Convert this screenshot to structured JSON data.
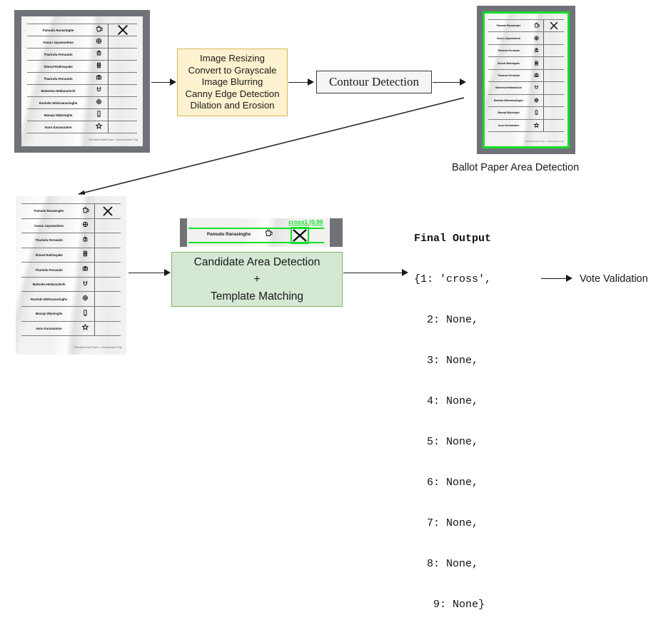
{
  "diagram": {
    "title": "Ballot paper vote detection pipeline",
    "colors": {
      "yellow_fill": "#fdf2cf",
      "yellow_stroke": "#d6b656",
      "green_fill": "#d5e8d4",
      "green_stroke": "#82b366",
      "white_fill": "#f5f5f5",
      "white_stroke": "#3a3a3a",
      "detection_green": "#12e029",
      "frame_gray": "#6f7277",
      "text": "#1a1a1a"
    }
  },
  "ballot": {
    "candidates": [
      {
        "name": "Pamudu Ranasinghe",
        "symbol": "cup"
      },
      {
        "name": "Kasun Jayawardena",
        "symbol": "wheel"
      },
      {
        "name": "Tharindu Fernando",
        "symbol": "lantern"
      },
      {
        "name": "Shenal Rathnayake",
        "symbol": "book"
      },
      {
        "name": "Tharindu Fernando",
        "symbol": "camera"
      },
      {
        "name": "Mahesha Hettiarachchi",
        "symbol": "magnet"
      },
      {
        "name": "Ravindu Wickramasinghe",
        "symbol": "gear"
      },
      {
        "name": "Manuja Wijesinghe",
        "symbol": "phone"
      },
      {
        "name": "Isuru Karunaratne",
        "symbol": "star"
      }
    ],
    "footnote": "*Simulated Ballot Paper – Demonstration Only",
    "mark_row_index": 0,
    "mark_symbol": "X"
  },
  "preprocess_box": {
    "lines": [
      "Image Resizing",
      "Convert to Grayscale",
      "Image Blurring",
      "Canny Edge Detection",
      "Dilation and Erosion"
    ]
  },
  "contour_box": {
    "label": "Contour Detection"
  },
  "ballot_area_caption": {
    "label": "Ballot Paper Area Detection"
  },
  "candidate_box": {
    "lines": [
      "Candidate Area Detection",
      "+",
      "Template Matching"
    ]
  },
  "crop_detail": {
    "row_name": "Pamudu Ranasinghe",
    "row_symbol": "cup",
    "match_label": "cross1 (0.99",
    "mark_symbol": "X"
  },
  "final_output": {
    "title": "Final Output",
    "lines": [
      "{1: 'cross',",
      "  2: None,",
      "  3: None,",
      "  4: None,",
      "  5: None,",
      "  6: None,",
      "  7: None,",
      "  8: None,",
      "   9: None}"
    ]
  },
  "vote_validation": {
    "label": "Vote Validation"
  }
}
